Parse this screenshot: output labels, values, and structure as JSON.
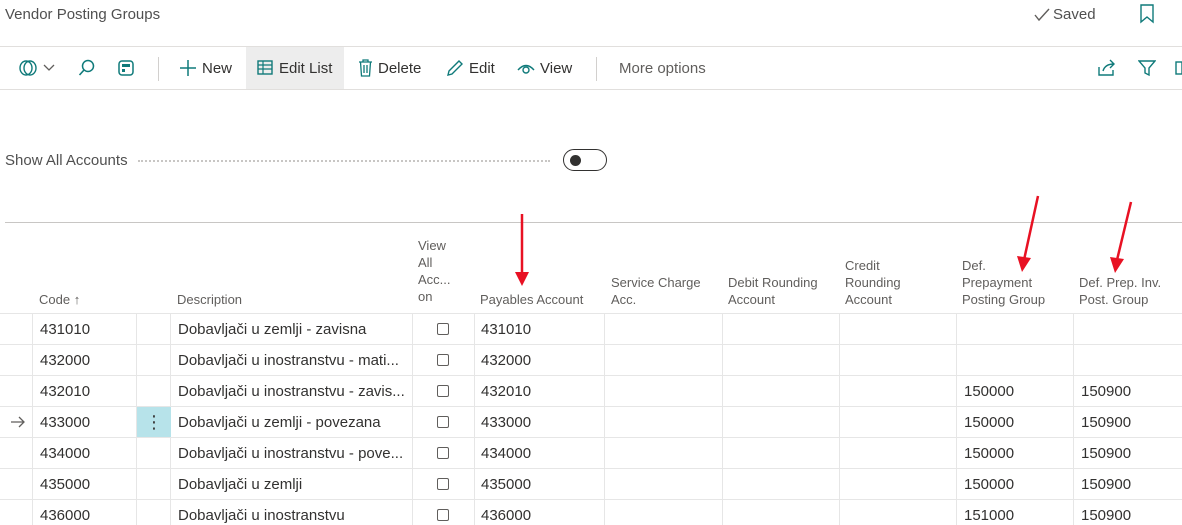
{
  "page": {
    "title": "Vendor Posting Groups",
    "saved_label": "Saved"
  },
  "toolbar": {
    "new_label": "New",
    "edit_list_label": "Edit List",
    "delete_label": "Delete",
    "edit_label": "Edit",
    "view_label": "View",
    "more_options_label": "More options"
  },
  "filter": {
    "show_all_accounts_label": "Show All Accounts",
    "show_all_accounts_value": false
  },
  "columns": {
    "code": "Code",
    "code_sort": "↑",
    "description": "Description",
    "view_all_1": "View",
    "view_all_2": "All",
    "view_all_3": "Acc...",
    "view_all_4": "on",
    "payables": "Payables Account",
    "service_1": "Service Charge",
    "service_2": "Acc.",
    "debit_1": "Debit Rounding",
    "debit_2": "Account",
    "credit_1": "Credit",
    "credit_2": "Rounding",
    "credit_3": "Account",
    "prepay_1": "Def.",
    "prepay_2": "Prepayment",
    "prepay_3": "Posting Group",
    "prepinv_1": "Def. Prep. Inv.",
    "prepinv_2": "Post. Group"
  },
  "rows": [
    {
      "code": "431010",
      "description": "Dobavljači u zemlji - zavisna",
      "payables": "431010",
      "prepay": "",
      "prepinv": ""
    },
    {
      "code": "432000",
      "description": "Dobavljači u inostranstvu - mati...",
      "payables": "432000",
      "prepay": "",
      "prepinv": ""
    },
    {
      "code": "432010",
      "description": "Dobavljači u inostranstvu - zavis...",
      "payables": "432010",
      "prepay": "150000",
      "prepinv": "150900"
    },
    {
      "code": "433000",
      "description": "Dobavljači u zemlji - povezana",
      "payables": "433000",
      "prepay": "150000",
      "prepinv": "150900"
    },
    {
      "code": "434000",
      "description": "Dobavljači u inostranstvu - pove...",
      "payables": "434000",
      "prepay": "150000",
      "prepinv": "150900"
    },
    {
      "code": "435000",
      "description": "Dobavljači u zemlji",
      "payables": "435000",
      "prepay": "150000",
      "prepinv": "150900"
    },
    {
      "code": "436000",
      "description": "Dobavljači u inostranstvu",
      "payables": "436000",
      "prepay": "151000",
      "prepinv": "150900"
    }
  ],
  "selected_row": 3,
  "colors": {
    "accent": "#0f7a7a",
    "selected_cell": "#b7e3ea",
    "annotation": "#e81123"
  }
}
